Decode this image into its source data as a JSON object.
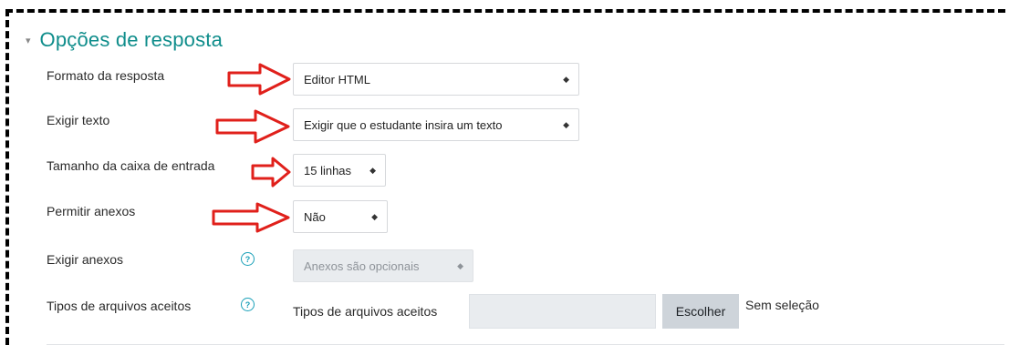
{
  "section": {
    "title": "Opções de resposta",
    "collapse_icon": "chevron-down-icon"
  },
  "fields": {
    "response_format": {
      "label": "Formato da resposta",
      "value": "Editor HTML"
    },
    "require_text": {
      "label": "Exigir texto",
      "value": "Exigir que o estudante insira um texto"
    },
    "input_box_size": {
      "label": "Tamanho da caixa de entrada",
      "value": "15 linhas"
    },
    "allow_attachments": {
      "label": "Permitir anexos",
      "value": "Não"
    },
    "require_attachments": {
      "label": "Exigir anexos",
      "value": "Anexos são opcionais",
      "disabled": true,
      "help_icon": "question-circle-icon"
    },
    "accepted_file_types": {
      "label": "Tipos de arquivos aceitos",
      "inner_label": "Tipos de arquivos aceitos",
      "button_label": "Escolher",
      "status": "Sem seleção",
      "help_icon": "question-circle-icon"
    }
  },
  "annotations": {
    "arrow_color": "#e0201b",
    "frame_color": "#000000"
  },
  "colors": {
    "accent": "#0f8d8b",
    "help_icon": "#1aa0b8",
    "disabled_bg": "#e9ecef",
    "button_bg": "#ced4da"
  }
}
